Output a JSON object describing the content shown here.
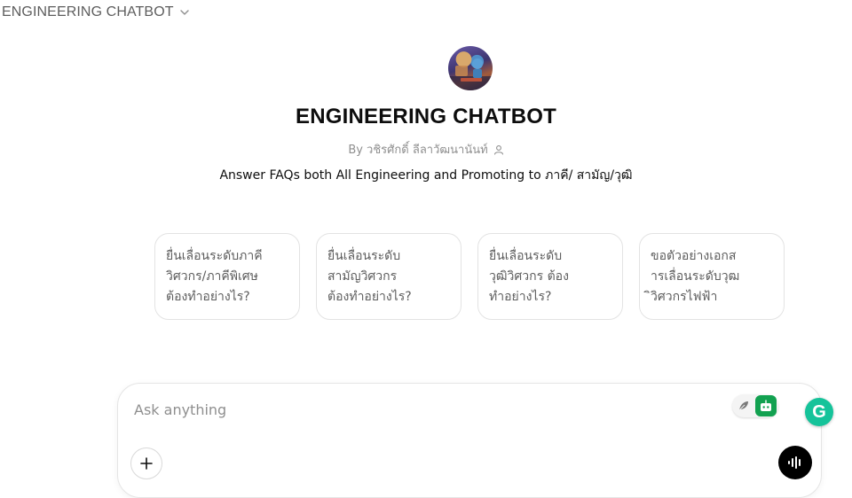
{
  "header": {
    "model_selector_label": "ENGINEERING CHATBOT"
  },
  "gpt": {
    "name": "ENGINEERING CHATBOT",
    "byline": "By วชิรศักดิ์ ลีลาวัฒนานันท์",
    "description": "Answer FAQs both All Engineering and Promoting to ภาคี/ สามัญ/วุฒิ"
  },
  "conversation_starters": [
    {
      "label": "ยื่นเลื่อนระดับภาคี\nวิศวกร/ภาคีพิเศษ\nต้องทำอย่างไร?"
    },
    {
      "label": "ยื่นเลื่อนระดับ\nสามัญวิศวกร\nต้องทำอย่างไร?"
    },
    {
      "label": "ยื่นเลื่อนระดับ\nวุฒิวิศวกร ต้อง\nทำอย่างไร?"
    },
    {
      "label": "ขอตัวอย่างเอกส\nารเลื่อนระดับวุฒ\nิวิศวกรไฟฟ้า"
    }
  ],
  "composer": {
    "placeholder": "Ask anything",
    "value": ""
  },
  "extensions": {
    "grammarly_letter": "G"
  },
  "icons": {
    "chevron": "chevron-down-icon",
    "person": "person-icon",
    "plus": "plus-icon",
    "voice": "voice-mode-icon",
    "leaf": "leaf-icon",
    "bot": "bot-icon",
    "grammarly": "grammarly-icon"
  },
  "colors": {
    "accent_green": "#12a150",
    "grammarly_green": "#15c39a",
    "voice_button": "#000000"
  }
}
